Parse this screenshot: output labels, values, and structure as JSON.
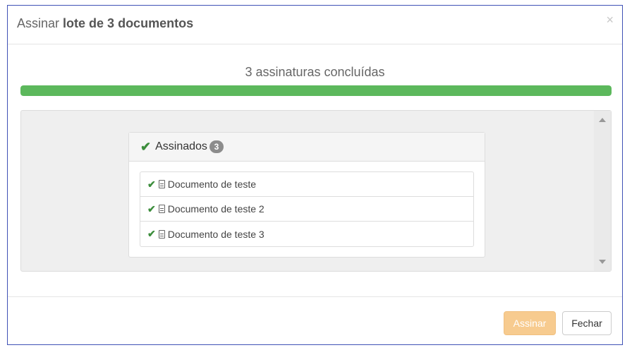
{
  "modal": {
    "title_prefix": "Assinar",
    "title_bold": "lote de 3 documentos",
    "close_label": "×"
  },
  "progress": {
    "label": "3 assinaturas concluídas",
    "fraction": 1.0,
    "color": "#5cb85c"
  },
  "panel": {
    "heading": "Assinados",
    "count": "3",
    "icon": "check-icon"
  },
  "documents": [
    {
      "label": "Documento de teste",
      "status_icon": "check-icon",
      "type_icon": "document-icon"
    },
    {
      "label": "Documento de teste 2",
      "status_icon": "check-icon",
      "type_icon": "document-icon"
    },
    {
      "label": "Documento de teste 3",
      "status_icon": "check-icon",
      "type_icon": "document-icon"
    }
  ],
  "footer": {
    "sign_label": "Assinar",
    "close_label": "Fechar"
  },
  "colors": {
    "accent_border": "#3f51b5",
    "success": "#3c8d3c",
    "sign_button": "#f7cb8f"
  }
}
